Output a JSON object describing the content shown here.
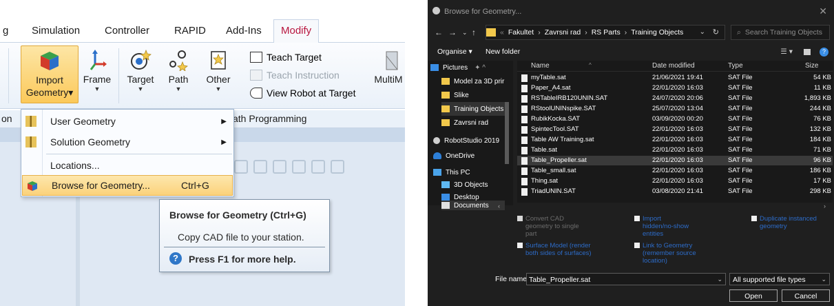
{
  "ribbon": {
    "tabs": [
      "g",
      "Simulation",
      "Controller",
      "RAPID",
      "Add-Ins",
      "Modify"
    ],
    "buttons": {
      "import_line1": "Import",
      "import_line2": "Geometry",
      "frame": "Frame",
      "target": "Target",
      "path": "Path",
      "other": "Other",
      "multi": "MultiM"
    },
    "small_buttons": {
      "teach_target": "Teach Target",
      "teach_instruction": "Teach Instruction",
      "view_robot": "View Robot at Target"
    },
    "group_labels": {
      "left": "on",
      "path_programming": "ath Programming"
    }
  },
  "import_menu": {
    "items": [
      {
        "label": "User Geometry"
      },
      {
        "label": "Solution Geometry"
      },
      {
        "label": "Locations..."
      },
      {
        "label": "Browse for Geometry...",
        "shortcut": "Ctrl+G"
      }
    ]
  },
  "tooltip": {
    "title": "Browse for Geometry (Ctrl+G)",
    "description": "Copy CAD file to your station.",
    "help": "Press F1 for more help."
  },
  "dialog": {
    "title": "Browse for Geometry...",
    "breadcrumb": [
      "Fakultet",
      "Zavrsni rad",
      "RS Parts",
      "Training Objects"
    ],
    "search_placeholder": "Search Training Objects",
    "toolbar": {
      "organise": "Organise ▾",
      "new_folder": "New folder"
    },
    "nav_items": [
      {
        "label": "Pictures",
        "color": "#3a8ee6"
      },
      {
        "label": "Model za 3D prir",
        "color": "#f2c84b"
      },
      {
        "label": "Slike",
        "color": "#f2c84b"
      },
      {
        "label": "Training Objects",
        "color": "#f2c84b"
      },
      {
        "label": "Zavrsni rad",
        "color": "#f2c84b"
      },
      {
        "label": "RobotStudio 2019",
        "color": "#cfcfcf"
      },
      {
        "label": "OneDrive",
        "color": "#2d7fd8"
      },
      {
        "label": "This PC",
        "color": "#4aa3ea"
      },
      {
        "label": "3D Objects",
        "color": "#5fb8f0"
      },
      {
        "label": "Desktop",
        "color": "#3a8ee6"
      },
      {
        "label": "Documents",
        "color": "#e0e0e0"
      }
    ],
    "columns": {
      "name": "Name",
      "date": "Date modified",
      "type": "Type",
      "size": "Size"
    },
    "files": [
      {
        "name": "myTable.sat",
        "date": "21/06/2021 19:41",
        "type": "SAT File",
        "size": "54 KB"
      },
      {
        "name": "Paper_A4.sat",
        "date": "22/01/2020 16:03",
        "type": "SAT File",
        "size": "11 KB"
      },
      {
        "name": "RSTableIRB120UNIN.SAT",
        "date": "24/07/2020 20:06",
        "type": "SAT File",
        "size": "1,893 KB"
      },
      {
        "name": "RStoolUNINspike.SAT",
        "date": "25/07/2020 13:04",
        "type": "SAT File",
        "size": "244 KB"
      },
      {
        "name": "RubikKocka.SAT",
        "date": "03/09/2020 00:20",
        "type": "SAT File",
        "size": "76 KB"
      },
      {
        "name": "SpintecTool.SAT",
        "date": "22/01/2020 16:03",
        "type": "SAT File",
        "size": "132 KB"
      },
      {
        "name": "Table AW Training.sat",
        "date": "22/01/2020 16:03",
        "type": "SAT File",
        "size": "184 KB"
      },
      {
        "name": "Table.sat",
        "date": "22/01/2020 16:03",
        "type": "SAT File",
        "size": "71 KB"
      },
      {
        "name": "Table_Propeller.sat",
        "date": "22/01/2020 16:03",
        "type": "SAT File",
        "size": "96 KB"
      },
      {
        "name": "Table_small.sat",
        "date": "22/01/2020 16:03",
        "type": "SAT File",
        "size": "186 KB"
      },
      {
        "name": "Thing.sat",
        "date": "22/01/2020 16:03",
        "type": "SAT File",
        "size": "17 KB"
      },
      {
        "name": "TriadUNIN.SAT",
        "date": "03/08/2020 21:41",
        "type": "SAT File",
        "size": "298 KB"
      }
    ],
    "options": {
      "convert_cad": [
        "Convert CAD",
        "geometry to single",
        "part"
      ],
      "import_hidden": [
        "Import",
        "hidden/no-show",
        "entities"
      ],
      "duplicate": [
        "Duplicate instanced",
        "geometry"
      ],
      "surface_model": [
        "Surface Model (render",
        "both sides of surfaces)"
      ],
      "link_geometry": [
        "Link to Geometry",
        "(remember source",
        "location)"
      ]
    },
    "file_name_label": "File name:",
    "file_name_value": "Table_Propeller.sat",
    "file_type": "All supported file types",
    "open": "Open",
    "cancel": "Cancel"
  }
}
